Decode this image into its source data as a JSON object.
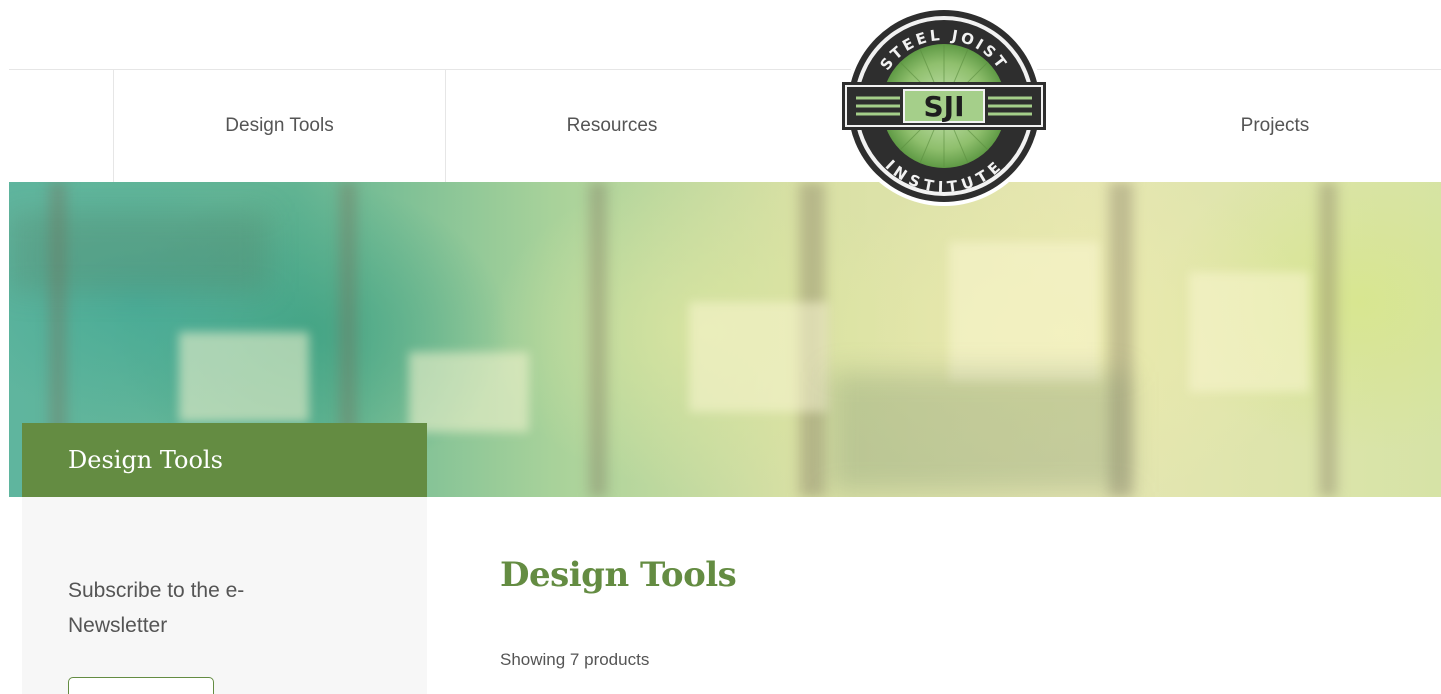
{
  "nav": {
    "items": [
      {
        "label": ""
      },
      {
        "label": "Design Tools"
      },
      {
        "label": "Resources"
      },
      {
        "label": "Projects"
      }
    ]
  },
  "logo": {
    "top_text": "STEEL JOIST",
    "center_text": "SJI",
    "bottom_text": "INSTITUTE",
    "colors": {
      "ring": "#2e2e2e",
      "sunburst": "#7fb060",
      "center": "#a5cf8a"
    }
  },
  "sidebar": {
    "title": "Design Tools",
    "subscribe_text": "Subscribe to the e-Newsletter",
    "button_label": ""
  },
  "main": {
    "title": "Design Tools",
    "product_count": "Showing 7 products"
  },
  "colors": {
    "accent": "#648c42",
    "text": "#555555",
    "border": "#e6e6e6",
    "sidebar_bg": "#f7f7f7"
  }
}
